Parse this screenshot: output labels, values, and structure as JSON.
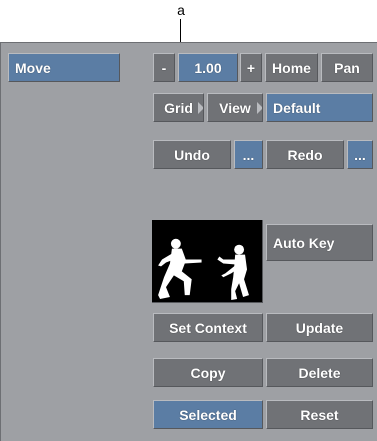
{
  "callout": {
    "label": "a"
  },
  "mode": {
    "label": "Move"
  },
  "zoom": {
    "minus_label": "-",
    "value": "1.00",
    "plus_label": "+",
    "home_label": "Home",
    "pan_label": "Pan"
  },
  "view": {
    "grid_label": "Grid",
    "view_label": "View",
    "default_label": "Default"
  },
  "history": {
    "undo_label": "Undo",
    "undo_more_label": "...",
    "redo_label": "Redo",
    "redo_more_label": "..."
  },
  "keyframe": {
    "auto_key_label": "Auto Key"
  },
  "actions": {
    "set_context_label": "Set Context",
    "update_label": "Update",
    "copy_label": "Copy",
    "delete_label": "Delete",
    "selected_label": "Selected",
    "reset_label": "Reset"
  },
  "colors": {
    "panel_bg": "#9ea0a4",
    "button_gray": "#707276",
    "button_blue": "#5b7da4",
    "text": "#ffffff"
  }
}
